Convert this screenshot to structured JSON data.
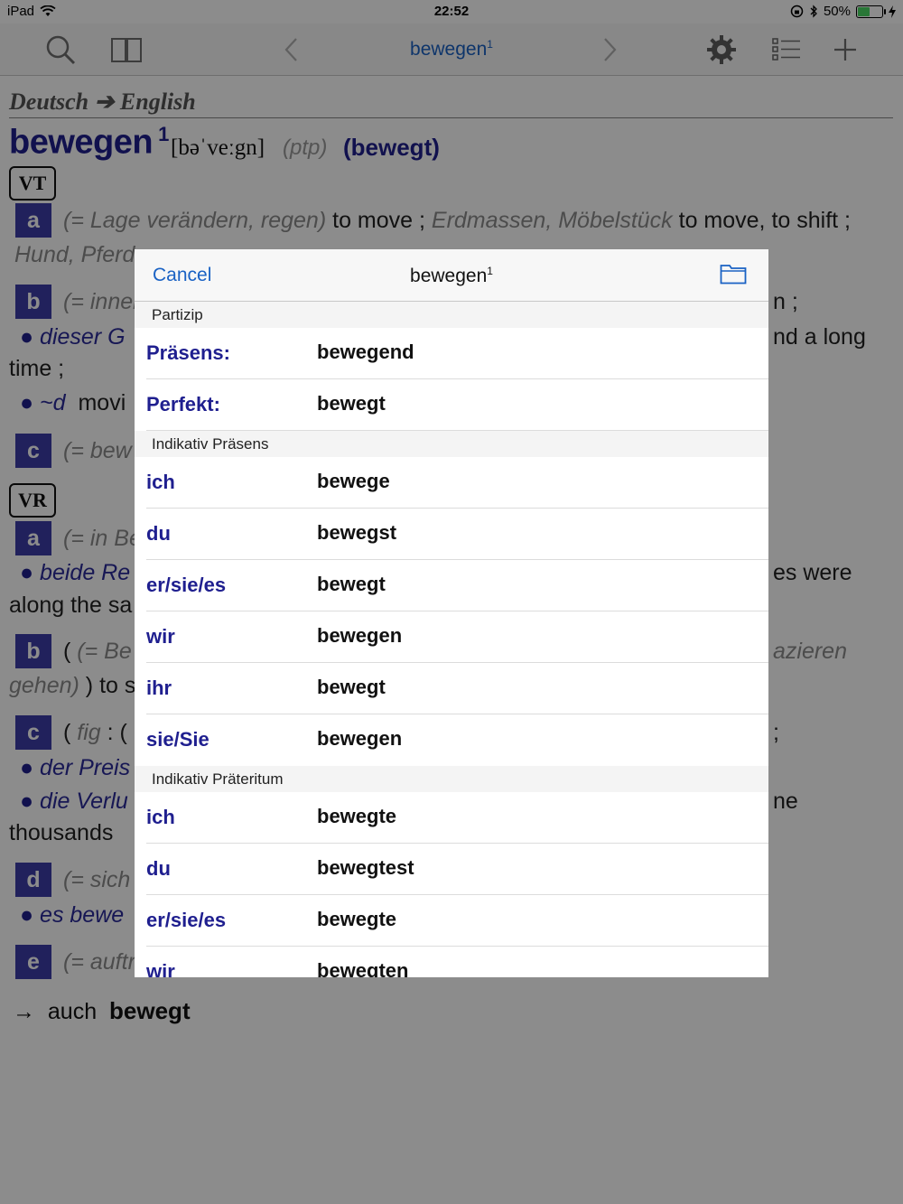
{
  "status": {
    "device": "iPad",
    "time": "22:52",
    "battery": "50%",
    "battery_level": 0.5
  },
  "toolbar": {
    "title": "bewegen",
    "title_sup": "1"
  },
  "entry": {
    "lang_pair": "Deutsch ➔ English",
    "headword": "bewegen",
    "homograph": "1",
    "pronunciation": "[bəˈveːgn]",
    "ptp_label": "(ptp)",
    "ptp_form": "(bewegt)",
    "vt_label": "VT",
    "vr_label": "VR",
    "sense_a": "a",
    "sense_b": "b",
    "sense_c": "c",
    "sense_d": "d",
    "sense_e": "e",
    "vt_a_gloss": "(= Lage verändern, regen)",
    "vt_a_trans": " to move ; ",
    "vt_a_gloss2": "Erdmassen, Möbelstück",
    "vt_a_trans2": " to move, to shift ;",
    "vt_a_line2": "Hund, Pferd",
    "vt_b_gloss": "(= inner",
    "vt_b_end": "n ;",
    "vt_b_ex": "dieser G",
    "vt_b_ex_end": "nd a long",
    "vt_b_line3": "time ;",
    "vt_b_ex2": "~d",
    "vt_b_ex2_trans": "movi",
    "vt_c_gloss": "(= bew",
    "vr_a_gloss": "(= in Be",
    "vr_a_ex": "beide Re",
    "vr_a_ex_end": "es were",
    "vr_a_line3": "along the sa",
    "vr_b_gloss": "(= Be",
    "vr_b_gloss_end": "azieren",
    "vr_b_line2_gloss": "gehen)",
    "vr_b_line2_trans": " ) to s",
    "vr_c_fig": "fig",
    "vr_c_end": ";",
    "vr_c_ex": "der Preis",
    "vr_c_ex2": "die Verlu",
    "vr_c_ex2_end": "ne",
    "vr_c_line4": "thousands",
    "vr_d_gloss": "(= sich",
    "vr_d_ex": "es bewe",
    "vr_e_gloss": "(= auftr",
    "xref_arrow": "→",
    "xref_label": "auch",
    "xref_word": "bewegt"
  },
  "popover": {
    "cancel_label": "Cancel",
    "title": "bewegen",
    "title_sup": "1",
    "sections": [
      {
        "header": "Partizip",
        "rows": [
          {
            "key": "Präsens:",
            "value": "bewegend"
          },
          {
            "key": "Perfekt:",
            "value": "bewegt"
          }
        ]
      },
      {
        "header": "Indikativ Präsens",
        "rows": [
          {
            "key": "ich",
            "value": "bewege"
          },
          {
            "key": "du",
            "value": "bewegst"
          },
          {
            "key": "er/sie/es",
            "value": "bewegt"
          },
          {
            "key": "wir",
            "value": "bewegen"
          },
          {
            "key": "ihr",
            "value": "bewegt"
          },
          {
            "key": "sie/Sie",
            "value": "bewegen"
          }
        ]
      },
      {
        "header": "Indikativ Präteritum",
        "rows": [
          {
            "key": "ich",
            "value": "bewegte"
          },
          {
            "key": "du",
            "value": "bewegtest"
          },
          {
            "key": "er/sie/es",
            "value": "bewegte"
          },
          {
            "key": "wir",
            "value": "bewegten"
          }
        ]
      }
    ]
  },
  "colors": {
    "link_blue": "#1a62c4",
    "headword_navy": "#1f1f8f",
    "sense_badge": "#3c3ca8"
  },
  "icons": [
    "wifi-icon",
    "lock-rotation-icon",
    "bluetooth-icon",
    "battery-icon",
    "charging-icon",
    "search-icon",
    "book-icon",
    "chevron-left-icon",
    "chevron-right-icon",
    "gear-icon",
    "list-icon",
    "plus-icon",
    "folder-icon"
  ]
}
